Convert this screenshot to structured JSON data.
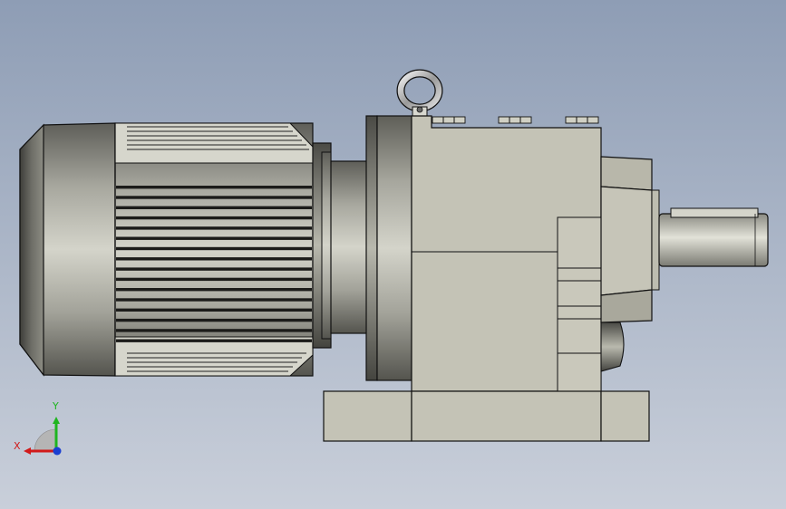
{
  "triad": {
    "x_label": "X",
    "y_label": "Y",
    "x_color": "#d11a1a",
    "y_color": "#1fb51f",
    "z_color": "#1a3fd1"
  },
  "model": {
    "body_color": "#c4c3b6",
    "edge_color": "#111111",
    "icon": "gear-motor-model"
  }
}
